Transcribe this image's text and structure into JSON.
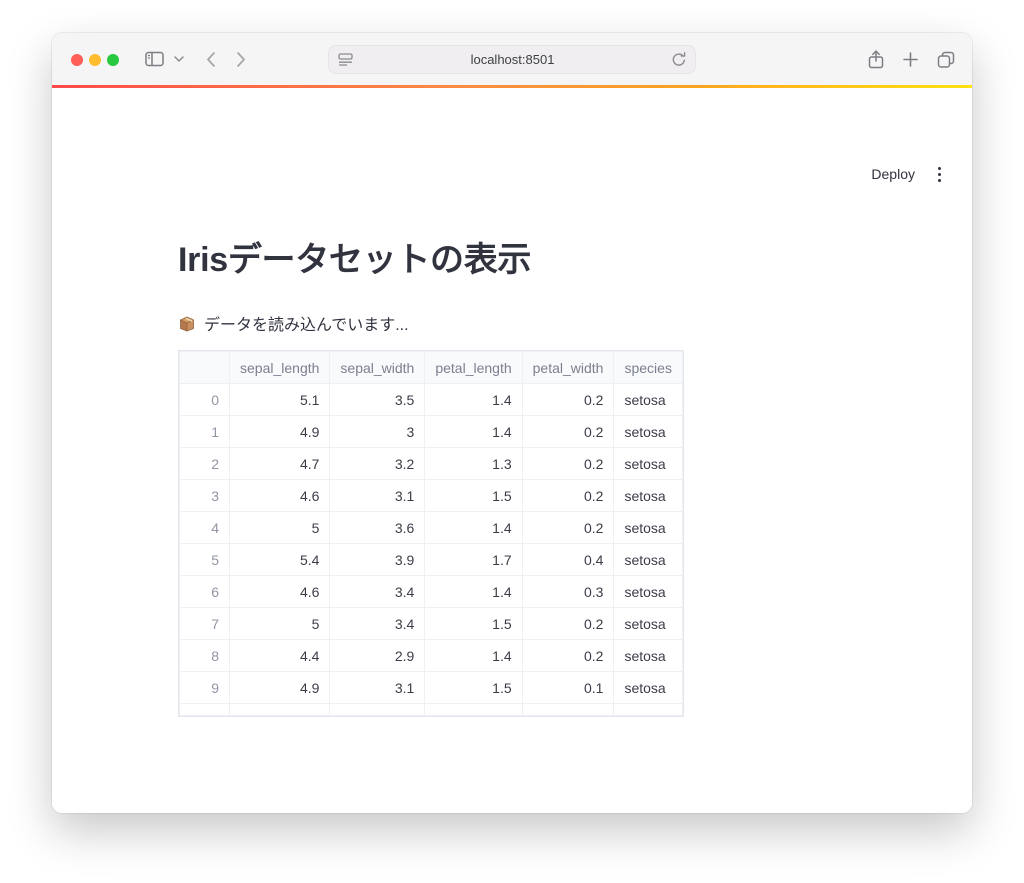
{
  "browser": {
    "url": "localhost:8501",
    "traffic_lights": {
      "close": "#ff5f57",
      "minimize": "#febc2e",
      "zoom": "#28c840"
    }
  },
  "streamlit": {
    "deploy_label": "Deploy",
    "page_title": "Irisデータセットの表示",
    "loading_icon": "📦",
    "loading_text": "データを読み込んでいます...",
    "decoration_gradient": [
      "#ff4b4b",
      "#ffa421",
      "#ffe312"
    ]
  },
  "table": {
    "columns": [
      "",
      "sepal_length",
      "sepal_width",
      "petal_length",
      "petal_width",
      "species"
    ],
    "rows": [
      [
        "0",
        "5.1",
        "3.5",
        "1.4",
        "0.2",
        "setosa"
      ],
      [
        "1",
        "4.9",
        "3",
        "1.4",
        "0.2",
        "setosa"
      ],
      [
        "2",
        "4.7",
        "3.2",
        "1.3",
        "0.2",
        "setosa"
      ],
      [
        "3",
        "4.6",
        "3.1",
        "1.5",
        "0.2",
        "setosa"
      ],
      [
        "4",
        "5",
        "3.6",
        "1.4",
        "0.2",
        "setosa"
      ],
      [
        "5",
        "5.4",
        "3.9",
        "1.7",
        "0.4",
        "setosa"
      ],
      [
        "6",
        "4.6",
        "3.4",
        "1.4",
        "0.3",
        "setosa"
      ],
      [
        "7",
        "5",
        "3.4",
        "1.5",
        "0.2",
        "setosa"
      ],
      [
        "8",
        "4.4",
        "2.9",
        "1.4",
        "0.2",
        "setosa"
      ],
      [
        "9",
        "4.9",
        "3.1",
        "1.5",
        "0.1",
        "setosa"
      ]
    ]
  }
}
